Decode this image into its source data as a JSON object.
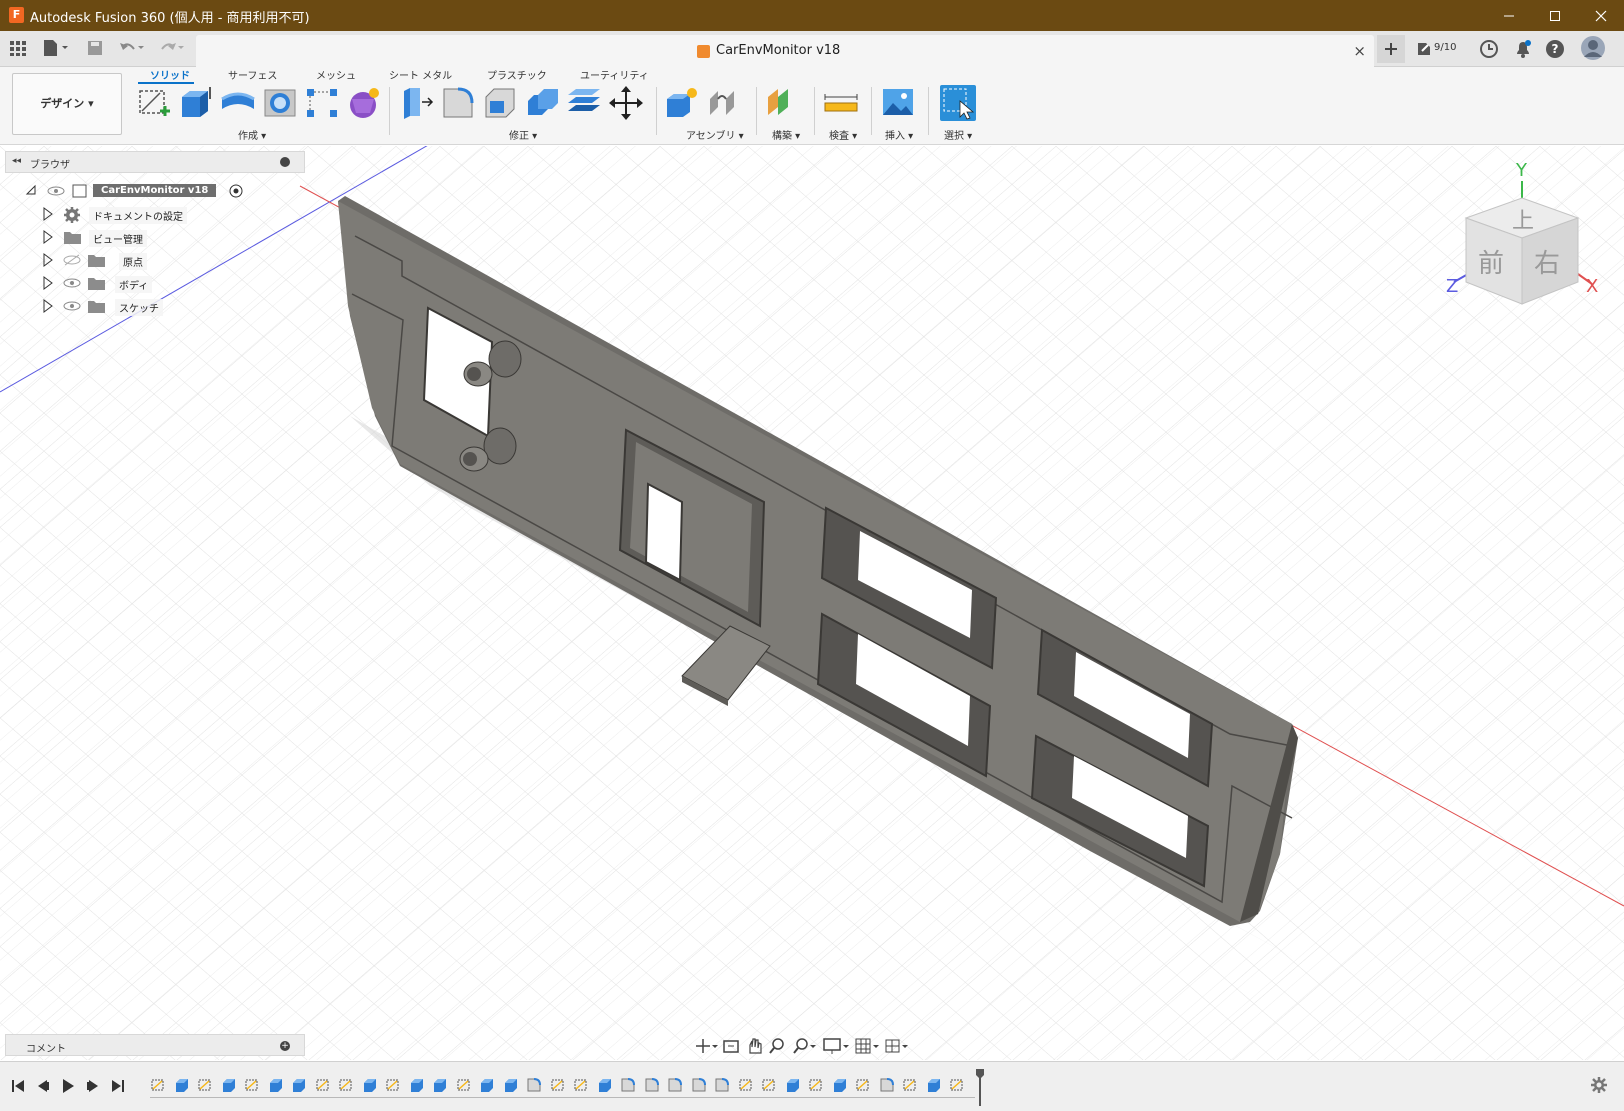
{
  "window": {
    "app_icon_letter": "F",
    "title": "Autodesk Fusion 360 (個人用 - 商用利用不可)"
  },
  "document_tab": {
    "title": "CarEnvMonitor v18",
    "close_glyph": "×"
  },
  "header_right": {
    "jobs_count": "9/10"
  },
  "ribbon": {
    "workspace_label": "デザイン",
    "tabs": [
      {
        "label": "ソリッド",
        "active": true
      },
      {
        "label": "サーフェス",
        "active": false
      },
      {
        "label": "メッシュ",
        "active": false
      },
      {
        "label": "シート メタル",
        "active": false
      },
      {
        "label": "プラスチック",
        "active": false
      },
      {
        "label": "ユーティリティ",
        "active": false
      }
    ],
    "groups": [
      {
        "label": "作成"
      },
      {
        "label": "修正"
      },
      {
        "label": "アセンブリ"
      },
      {
        "label": "構築"
      },
      {
        "label": "検査"
      },
      {
        "label": "挿入"
      },
      {
        "label": "選択"
      }
    ]
  },
  "browser": {
    "title": "ブラウザ",
    "root": {
      "label": "CarEnvMonitor v18"
    },
    "nodes": [
      {
        "label": "ドキュメントの設定",
        "icon": "gear-icon"
      },
      {
        "label": "ビュー管理",
        "icon": "folder-icon"
      },
      {
        "label": "原点",
        "icon": "folder-icon",
        "visibility": "hidden"
      },
      {
        "label": "ボディ",
        "icon": "folder-icon",
        "visibility": "visible"
      },
      {
        "label": "スケッチ",
        "icon": "folder-icon",
        "visibility": "visible"
      }
    ]
  },
  "viewcube": {
    "top": "上",
    "front": "前",
    "right": "右",
    "axis_x": "X",
    "axis_y": "Y",
    "axis_z": "Z"
  },
  "comments": {
    "title": "コメント"
  },
  "timeline": {
    "feature_count": 35
  },
  "colors": {
    "titlebar": "#6b4a12",
    "accent": "#0a72c9",
    "model_face": "#7d7b76",
    "x_axis": "#e05050",
    "z_axis": "#5b5be0",
    "y_axis": "#3cb84a"
  }
}
